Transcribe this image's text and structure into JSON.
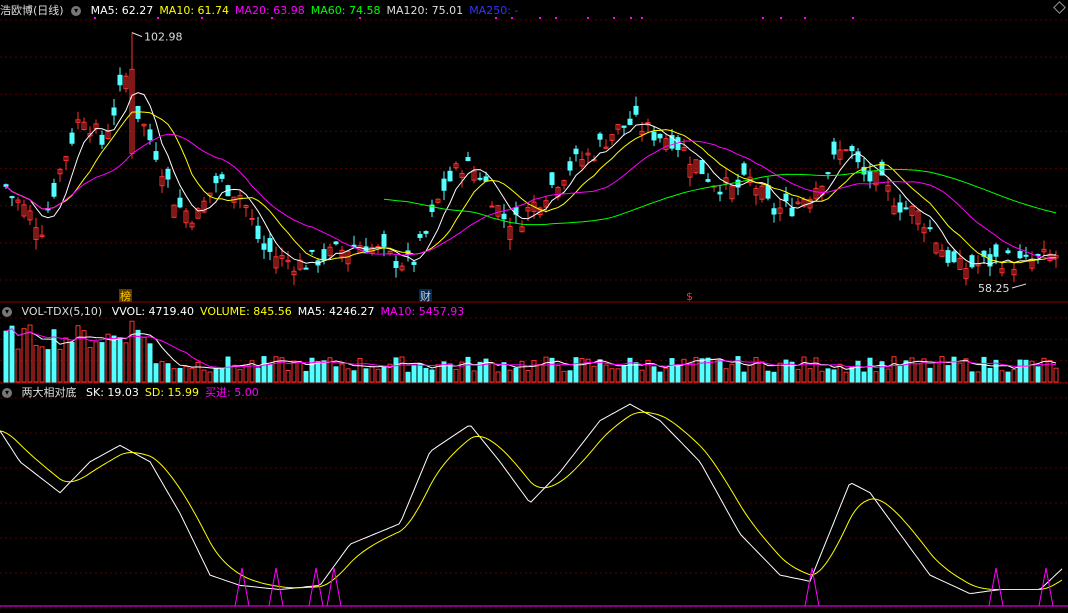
{
  "panel_price": {
    "stock": "浩欧博(日线)",
    "ma": [
      {
        "label": "MA5: 62.27",
        "color": "#ffffff"
      },
      {
        "label": "MA10: 61.74",
        "color": "#ffff00"
      },
      {
        "label": "MA20: 63.98",
        "color": "#ff00ff"
      },
      {
        "label": "MA60: 74.58",
        "color": "#00ff00"
      },
      {
        "label": "MA120: 75.01",
        "color": "#dddddd"
      },
      {
        "label": "MA250: -",
        "color": "#3333ff"
      }
    ],
    "high_label": "102.98",
    "low_label": "58.25",
    "markers": [
      {
        "text": "榜",
        "color": "#ffcc00"
      },
      {
        "text": "财",
        "color": "#cccccc"
      },
      {
        "text": "$",
        "color": "#ff3030"
      }
    ]
  },
  "panel_volume": {
    "name": "VOL-TDX(5,10)",
    "items": [
      {
        "label": "VVOL: 4719.40",
        "color": "#ffffff"
      },
      {
        "label": "VOLUME: 845.56",
        "color": "#ffff00"
      },
      {
        "label": "MA5: 4246.27",
        "color": "#ffffff"
      },
      {
        "label": "MA10: 5457.93",
        "color": "#ff00ff"
      }
    ]
  },
  "panel_indicator": {
    "name": "两大相对底",
    "items": [
      {
        "label": "SK: 19.03",
        "color": "#ffffff"
      },
      {
        "label": "SD: 15.99",
        "color": "#ffff00"
      },
      {
        "label": "买进: 5.00",
        "color": "#ff00ff"
      }
    ]
  },
  "colors": {
    "up": "#ff3030",
    "down": "#54ffff",
    "ma5": "#ffffff",
    "ma10": "#ffff00",
    "ma20": "#ff00ff",
    "ma60": "#00ff00",
    "grid": "#5a0000"
  }
}
